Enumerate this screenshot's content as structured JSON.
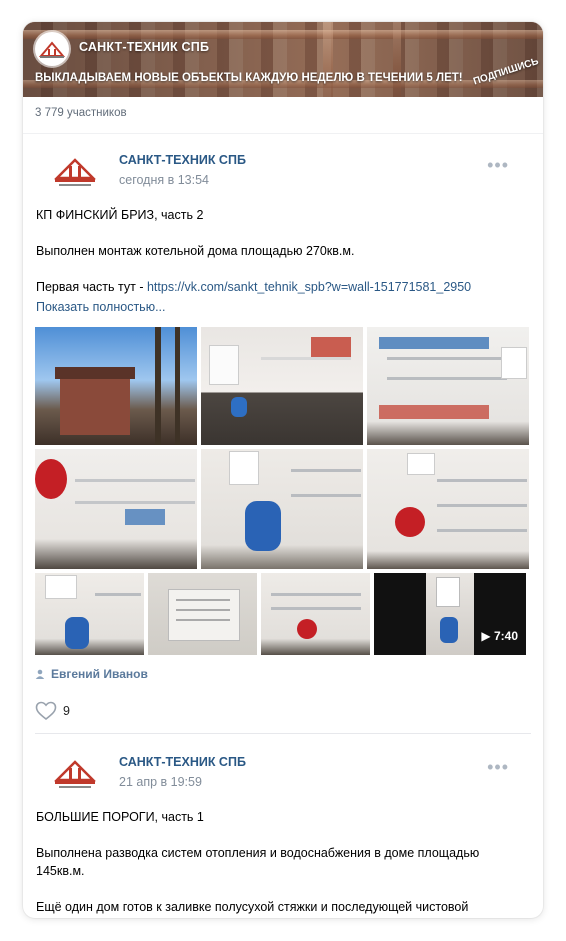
{
  "group": {
    "name": "САНКТ-ТЕХНИК СПБ",
    "cover_tagline": "ВЫКЛАДЫВАЕМ НОВЫЕ ОБЪЕКТЫ КАЖДУЮ НЕДЕЛЮ В ТЕЧЕНИИ 5 ЛЕТ!",
    "cover_stamp": "ПОДПИШИСЬ",
    "members": "3 779 участников"
  },
  "posts": [
    {
      "author": "САНКТ-ТЕХНИК СПБ",
      "date": "сегодня в 13:54",
      "more": "•••",
      "title": "КП ФИНСКИЙ БРИЗ, часть 2",
      "body": "Выполнен монтаж котельной дома площадью 270кв.м.",
      "link_prefix": "Первая часть тут - ",
      "link": "https://vk.com/sankt_tehnik_spb?w=wall-151771581_2950",
      "show_more": "Показать полностью...",
      "video_duration": "7:40",
      "signer": "Евгений Иванов",
      "likes": "9"
    },
    {
      "author": "САНКТ-ТЕХНИК СПБ",
      "date": "21 апр в 19:59",
      "more": "•••",
      "title": "БОЛЬШИЕ ПОРОГИ, часть 1",
      "body": "Выполнена разводка систем отопления и водоснабжения в доме площадью 145кв.м.",
      "body2": "Ещё один дом готов к заливке полусухой стяжки и последующей чистовой"
    }
  ],
  "colors": {
    "link": "#2a5885",
    "muted": "#818c99",
    "accent_red": "#c0392b"
  }
}
